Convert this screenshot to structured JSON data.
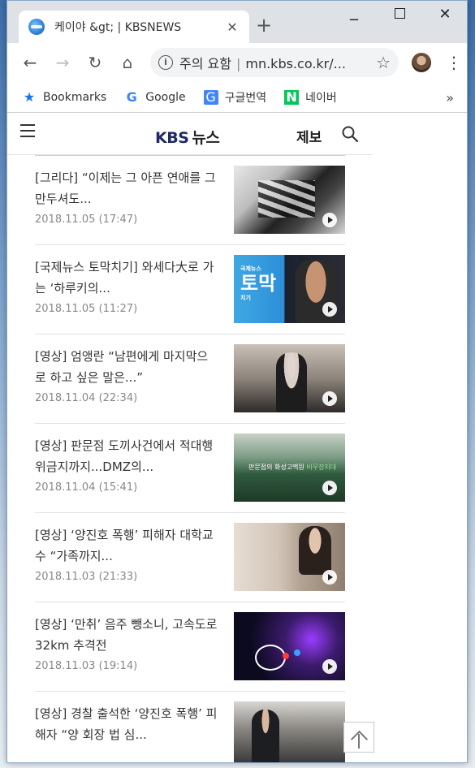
{
  "browser": {
    "tab_title": "케이야 &gt; | KBSNEWS",
    "new_tab": "+",
    "tab_close": "✕",
    "omnibox_warning": "주의 요함",
    "omnibox_url": "mn.kbs.co.kr/..."
  },
  "bookmarks": [
    {
      "label": "Bookmarks",
      "icon": "star-icon"
    },
    {
      "label": "Google",
      "icon": "google-icon"
    },
    {
      "label": "구글번역",
      "icon": "translate-icon"
    },
    {
      "label": "네이버",
      "icon": "naver-icon"
    }
  ],
  "bookmarks_more": "»",
  "site": {
    "logo_kbs": "KBS",
    "logo_news": "뉴스",
    "report_label": "제보"
  },
  "articles": [
    {
      "title": "[그리다] “이제는 그 아픈 연애를 그만두셔도...",
      "date": "2018.11.05 (17:47)"
    },
    {
      "title": "[국제뉴스 토막치기] 와세다大로 가는 ‘하루키의...",
      "date": "2018.11.05 (11:27)"
    },
    {
      "title": "[영상] 엄앵란 “남편에게 마지막으로 하고 싶은 말은...”",
      "date": "2018.11.04 (22:34)"
    },
    {
      "title": "[영상] 판문점 도끼사건에서 적대행위금지까지...DMZ의...",
      "date": "2018.11.04 (15:41)"
    },
    {
      "title": "[영상] ‘양진호 폭행’ 피해자 대학교수 “가족까지...",
      "date": "2018.11.03 (21:33)"
    },
    {
      "title": "[영상] ‘만취’ 음주 뺑소니, 고속도로 32km 추격전",
      "date": "2018.11.03 (19:14)"
    },
    {
      "title": "[영상] 경찰 출석한 ‘양진호 폭행’ 피해자 “양 회장 법 심...",
      "date": ""
    }
  ],
  "thumb_labels": {
    "t2_top": "국제뉴스",
    "t2_main": "토막",
    "t2_sub": "치기",
    "t4_main": "판문점의 화성고맥원",
    "t4_sub": "비무장지대"
  }
}
